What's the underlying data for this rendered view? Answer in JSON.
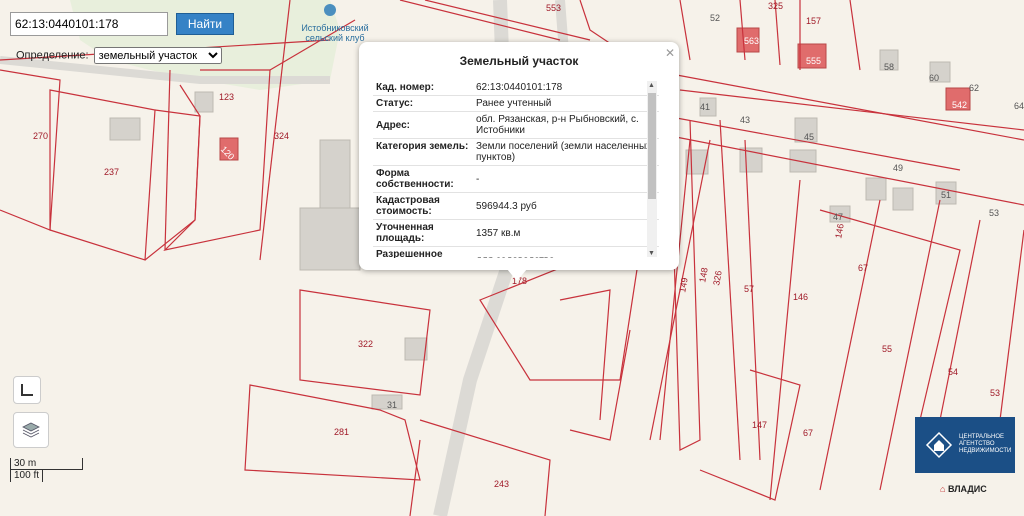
{
  "search": {
    "value": "62:13:0440101:178",
    "button_label": "Найти"
  },
  "definition": {
    "label": "Определение:",
    "selected": "земельный участок"
  },
  "poi": {
    "label": "Истобниковский сельский клуб"
  },
  "popup": {
    "title": "Земельный участок",
    "rows": [
      {
        "key": "Кад. номер:",
        "value": "62:13:0440101:178"
      },
      {
        "key": "Статус:",
        "value": "Ранее учтенный"
      },
      {
        "key": "Адрес:",
        "value": "обл. Рязанская, р-н Рыбновский, с. Истобники"
      },
      {
        "key": "Категория земель:",
        "value": "Земли поселений (земли населенных пунктов)"
      },
      {
        "key": "Форма собственности:",
        "value": "-"
      },
      {
        "key": "Кадастровая стоимость:",
        "value": "596944.3 руб"
      },
      {
        "key": "Уточненная площадь:",
        "value": "1357 кв.м"
      },
      {
        "key": "Разрешенное",
        "value": "для садоводства"
      }
    ]
  },
  "scale": {
    "metric": "30 m",
    "imperial": "100 ft"
  },
  "logo": {
    "text": "ЦЕНТРАЛЬНОЕ АГЕНТСТВО НЕДВИЖИМОСТИ",
    "brand": "ВЛАДИС"
  },
  "colors": {
    "parcel_border": "#c8323c",
    "parcel_label": "#a01a28",
    "building": "#d9d6d0",
    "highlighted_building": "#e06c6c",
    "park": "#e8efdc",
    "button": "#3582c6"
  },
  "parcels": [
    "553",
    "52",
    "325",
    "157",
    "123",
    "324",
    "270",
    "237",
    "58",
    "60",
    "62",
    "64",
    "41",
    "43",
    "45",
    "49",
    "51",
    "53",
    "47",
    "146",
    "67",
    "55",
    "54",
    "53",
    "148",
    "149",
    "326",
    "57",
    "146",
    "178",
    "322",
    "31",
    "281",
    "243",
    "147",
    "67"
  ],
  "house_numbers": [
    "555",
    "563",
    "542",
    "120"
  ]
}
